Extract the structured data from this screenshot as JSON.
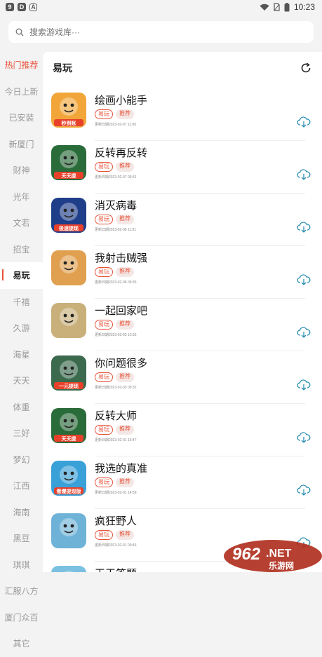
{
  "status": {
    "time": "10:23"
  },
  "search": {
    "placeholder": "搜索游戏库···"
  },
  "sidebar": {
    "items": [
      {
        "label": "热门推荐"
      },
      {
        "label": "今日上新"
      },
      {
        "label": "已安装"
      },
      {
        "label": "新厦门"
      },
      {
        "label": "财神"
      },
      {
        "label": "光年"
      },
      {
        "label": "文若"
      },
      {
        "label": "招宝"
      },
      {
        "label": "易玩"
      },
      {
        "label": "千禧"
      },
      {
        "label": "久游"
      },
      {
        "label": "海星"
      },
      {
        "label": "天天"
      },
      {
        "label": "体重"
      },
      {
        "label": "三好"
      },
      {
        "label": "梦幻"
      },
      {
        "label": "江西"
      },
      {
        "label": "海南"
      },
      {
        "label": "黑豆"
      },
      {
        "label": "琪琪"
      },
      {
        "label": "汇服八方"
      },
      {
        "label": "厦门众百"
      },
      {
        "label": "其它"
      }
    ],
    "active_index": 8
  },
  "content": {
    "title": "易玩",
    "games": [
      {
        "name": "绘画小能手",
        "tag1": "易玩",
        "tag2": "推荐",
        "updated": "更新日期2023-02-07 11:00",
        "thumb_bg": "#f2a63a",
        "thumb_text": "秒到账"
      },
      {
        "name": "反转再反转",
        "tag1": "易玩",
        "tag2": "推荐",
        "updated": "更新日期2023-02-07 09:31",
        "thumb_bg": "#2a6b3a",
        "thumb_text": "天天提"
      },
      {
        "name": "消灭病毒",
        "tag1": "易玩",
        "tag2": "推荐",
        "updated": "更新日期2023-02-06 11:01",
        "thumb_bg": "#1f3e8a",
        "thumb_text": "极速提现"
      },
      {
        "name": "我射击贼强",
        "tag1": "易玩",
        "tag2": "推荐",
        "updated": "更新日期2023-02-06 09:36",
        "thumb_bg": "#e0a050",
        "thumb_text": ""
      },
      {
        "name": "一起回家吧",
        "tag1": "易玩",
        "tag2": "推荐",
        "updated": "更新日期2023-02-03 10:35",
        "thumb_bg": "#c9b07a",
        "thumb_text": ""
      },
      {
        "name": "你问题很多",
        "tag1": "易玩",
        "tag2": "推荐",
        "updated": "更新日期2023-02-03 09:32",
        "thumb_bg": "#3b6a4d",
        "thumb_text": "一元提现"
      },
      {
        "name": "反转大师",
        "tag1": "易玩",
        "tag2": "推荐",
        "updated": "更新日期2023-02-01 15:47",
        "thumb_bg": "#2a6b3a",
        "thumb_text": "天天提"
      },
      {
        "name": "我选的真准",
        "tag1": "易玩",
        "tag2": "推荐",
        "updated": "更新日期2023-02-01 14:58",
        "thumb_bg": "#3aa0d8",
        "thumb_text": "看爆提现版"
      },
      {
        "name": "疯狂野人",
        "tag1": "易玩",
        "tag2": "推荐",
        "updated": "更新日期2023-02-01 09:46",
        "thumb_bg": "#6fb2d8",
        "thumb_text": ""
      },
      {
        "name": "天天答题",
        "tag1": "",
        "tag2": "",
        "updated": "",
        "thumb_bg": "#7ac0e0",
        "thumb_text": ""
      }
    ]
  },
  "watermark": {
    "number": "962",
    "suffix": ".NET",
    "sub": "乐游网"
  },
  "colors": {
    "accent": "#e8533a",
    "download": "#2a8fb0"
  }
}
